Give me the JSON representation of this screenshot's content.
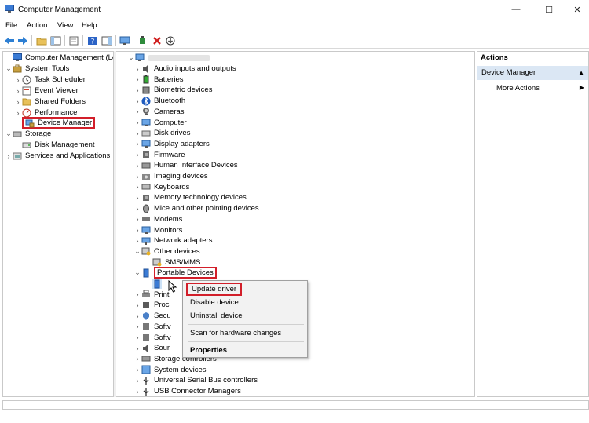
{
  "window": {
    "title": "Computer Management",
    "minimize": "—",
    "maximize": "☐",
    "close": "✕"
  },
  "menu": [
    "File",
    "Action",
    "View",
    "Help"
  ],
  "left_tree": {
    "root": "Computer Management (Local",
    "system_tools": "System Tools",
    "task_scheduler": "Task Scheduler",
    "event_viewer": "Event Viewer",
    "shared_folders": "Shared Folders",
    "performance": "Performance",
    "device_manager": "Device Manager",
    "storage": "Storage",
    "disk_management": "Disk Management",
    "services": "Services and Applications"
  },
  "device_tree": {
    "categories": [
      "Audio inputs and outputs",
      "Batteries",
      "Biometric devices",
      "Bluetooth",
      "Cameras",
      "Computer",
      "Disk drives",
      "Display adapters",
      "Firmware",
      "Human Interface Devices",
      "Imaging devices",
      "Keyboards",
      "Memory technology devices",
      "Mice and other pointing devices",
      "Modems",
      "Monitors",
      "Network adapters",
      "Other devices"
    ],
    "other_child": "SMS/MMS",
    "portable": "Portable Devices",
    "partial": [
      "Print",
      "Proc",
      "Secu",
      "Softv",
      "Softv",
      "Sour"
    ],
    "after": [
      "Storage controllers",
      "System devices",
      "Universal Serial Bus controllers",
      "USB Connector Managers"
    ]
  },
  "context_menu": {
    "update": "Update driver",
    "disable": "Disable device",
    "uninstall": "Uninstall device",
    "scan": "Scan for hardware changes",
    "properties": "Properties"
  },
  "actions": {
    "title": "Actions",
    "section": "Device Manager",
    "more": "More Actions"
  },
  "colors": {
    "highlight_border": "#d21f2a",
    "actions_section_bg": "#dbe7f4"
  }
}
